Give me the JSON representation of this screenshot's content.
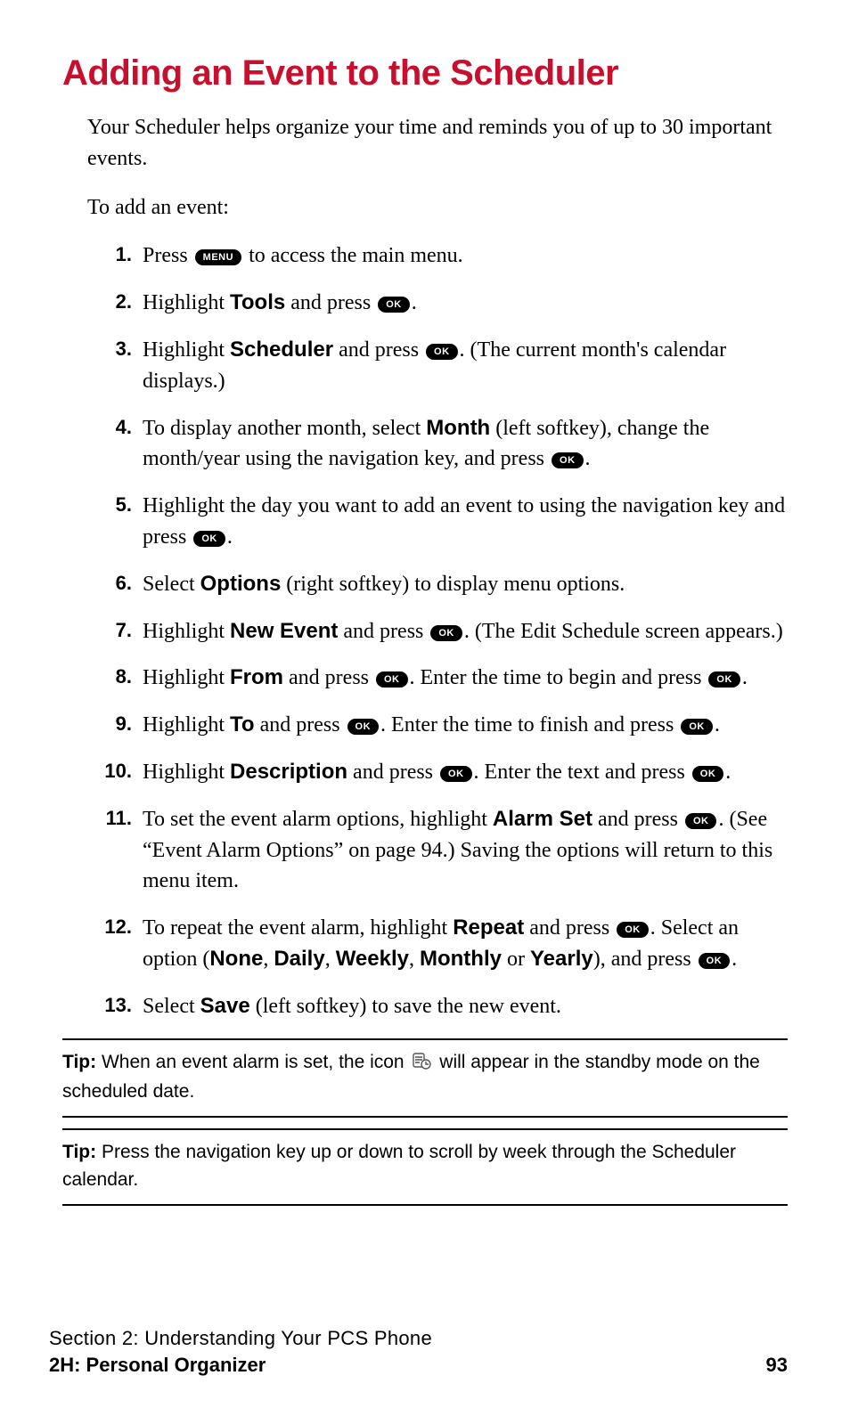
{
  "title": "Adding an Event to the Scheduler",
  "intro": "Your Scheduler helps organize your time and reminds you of up to 30 important events.",
  "lead": "To add an event:",
  "keys": {
    "menu": "MENU",
    "ok": "OK"
  },
  "steps": {
    "s1": {
      "n": "1.",
      "a": "Press ",
      "b": " to access the main menu."
    },
    "s2": {
      "n": "2.",
      "a": "Highlight ",
      "bold1": "Tools",
      "b": " and press ",
      "c": "."
    },
    "s3": {
      "n": "3.",
      "a": "Highlight ",
      "bold1": "Scheduler",
      "b": " and press ",
      "c": ". (The current month's calendar displays.)"
    },
    "s4": {
      "n": "4.",
      "a": "To display another month, select ",
      "bold1": "Month",
      "b": " (left softkey), change the month/year using the navigation key, and press ",
      "c": "."
    },
    "s5": {
      "n": "5.",
      "a": "Highlight the day you want to add an event to using the navigation key and press ",
      "b": "."
    },
    "s6": {
      "n": "6.",
      "a": "Select ",
      "bold1": "Options",
      "b": " (right softkey) to display menu options."
    },
    "s7": {
      "n": "7.",
      "a": "Highlight ",
      "bold1": "New Event",
      "b": " and press ",
      "c": ". (The Edit Schedule screen appears.)"
    },
    "s8": {
      "n": "8.",
      "a": "Highlight ",
      "bold1": "From",
      "b": " and press ",
      "c": ". Enter the time to begin and press ",
      "d": "."
    },
    "s9": {
      "n": "9.",
      "a": "Highlight ",
      "bold1": "To",
      "b": " and press ",
      "c": ". Enter the time to finish and press ",
      "d": "."
    },
    "s10": {
      "n": "10.",
      "a": "Highlight ",
      "bold1": "Description",
      "b": " and press ",
      "c": ". Enter the text and press ",
      "d": "."
    },
    "s11": {
      "n": "11.",
      "a": "To set the event alarm options, highlight ",
      "bold1": "Alarm Set",
      "b": " and press ",
      "c": ". (See “Event Alarm Options” on page 94.) Saving the options will return to this menu item."
    },
    "s12": {
      "n": "12.",
      "a": "To repeat the event alarm, highlight ",
      "bold1": "Repeat",
      "b": " and press ",
      "c": ". Select an option (",
      "o1": "None",
      "comma1": ", ",
      "o2": "Daily",
      "comma2": ", ",
      "o3": "Weekly",
      "comma3": ", ",
      "o4": "Monthly",
      "or": " or ",
      "o5": "Yearly",
      "d": "), and press ",
      "e": "."
    },
    "s13": {
      "n": "13.",
      "a": "Select ",
      "bold1": "Save",
      "b": " (left softkey) to save the new event."
    }
  },
  "tips": {
    "label": "Tip:",
    "t1a": " When an event alarm is set, the icon ",
    "t1b": " will appear in the standby mode on the scheduled date.",
    "t2": " Press the navigation key up or down to scroll by week through the Scheduler calendar."
  },
  "footer": {
    "section": "Section 2: Understanding Your PCS Phone",
    "chapter": "2H: Personal Organizer",
    "page": "93"
  }
}
